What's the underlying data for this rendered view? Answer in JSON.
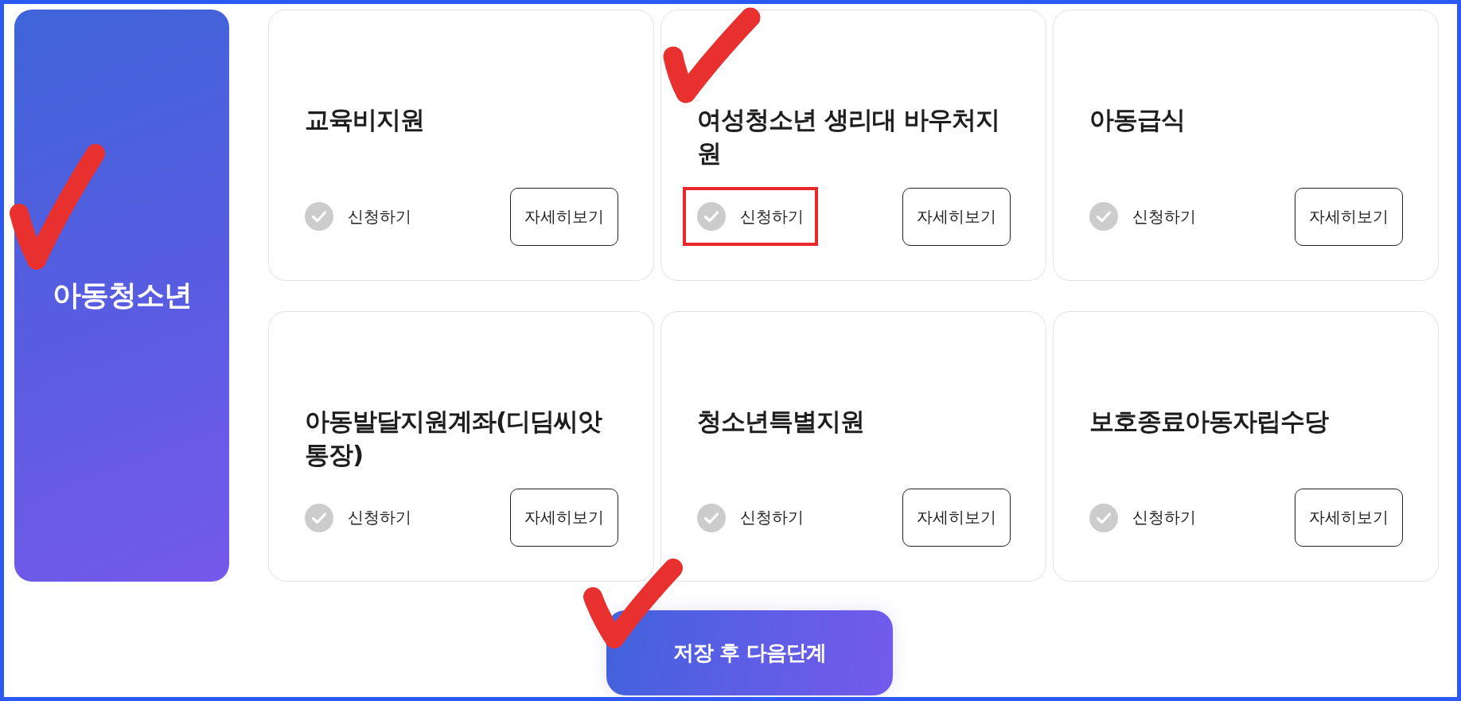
{
  "category": {
    "label": "아동청소년",
    "check_annotation": true
  },
  "cards": [
    {
      "title": "교육비지원",
      "apply": {
        "label": "신청하기",
        "checked": false,
        "highlighted": false
      },
      "details": "자세히보기",
      "check_annotation": false
    },
    {
      "title": "여성청소년 생리대 바우처지원",
      "apply": {
        "label": "신청하기",
        "checked": false,
        "highlighted": true
      },
      "details": "자세히보기",
      "check_annotation": true
    },
    {
      "title": "아동급식",
      "apply": {
        "label": "신청하기",
        "checked": false,
        "highlighted": false
      },
      "details": "자세히보기",
      "check_annotation": false
    },
    {
      "title": "아동발달지원계좌(디딤씨앗통장)",
      "apply": {
        "label": "신청하기",
        "checked": false,
        "highlighted": false
      },
      "details": "자세히보기",
      "check_annotation": false
    },
    {
      "title": "청소년특별지원",
      "apply": {
        "label": "신청하기",
        "checked": false,
        "highlighted": false
      },
      "details": "자세히보기",
      "check_annotation": false
    },
    {
      "title": "보호종료아동자립수당",
      "apply": {
        "label": "신청하기",
        "checked": false,
        "highlighted": false
      },
      "details": "자세히보기",
      "check_annotation": false
    }
  ],
  "save_button": {
    "label": "저장 후 다음단계",
    "check_annotation": true
  }
}
